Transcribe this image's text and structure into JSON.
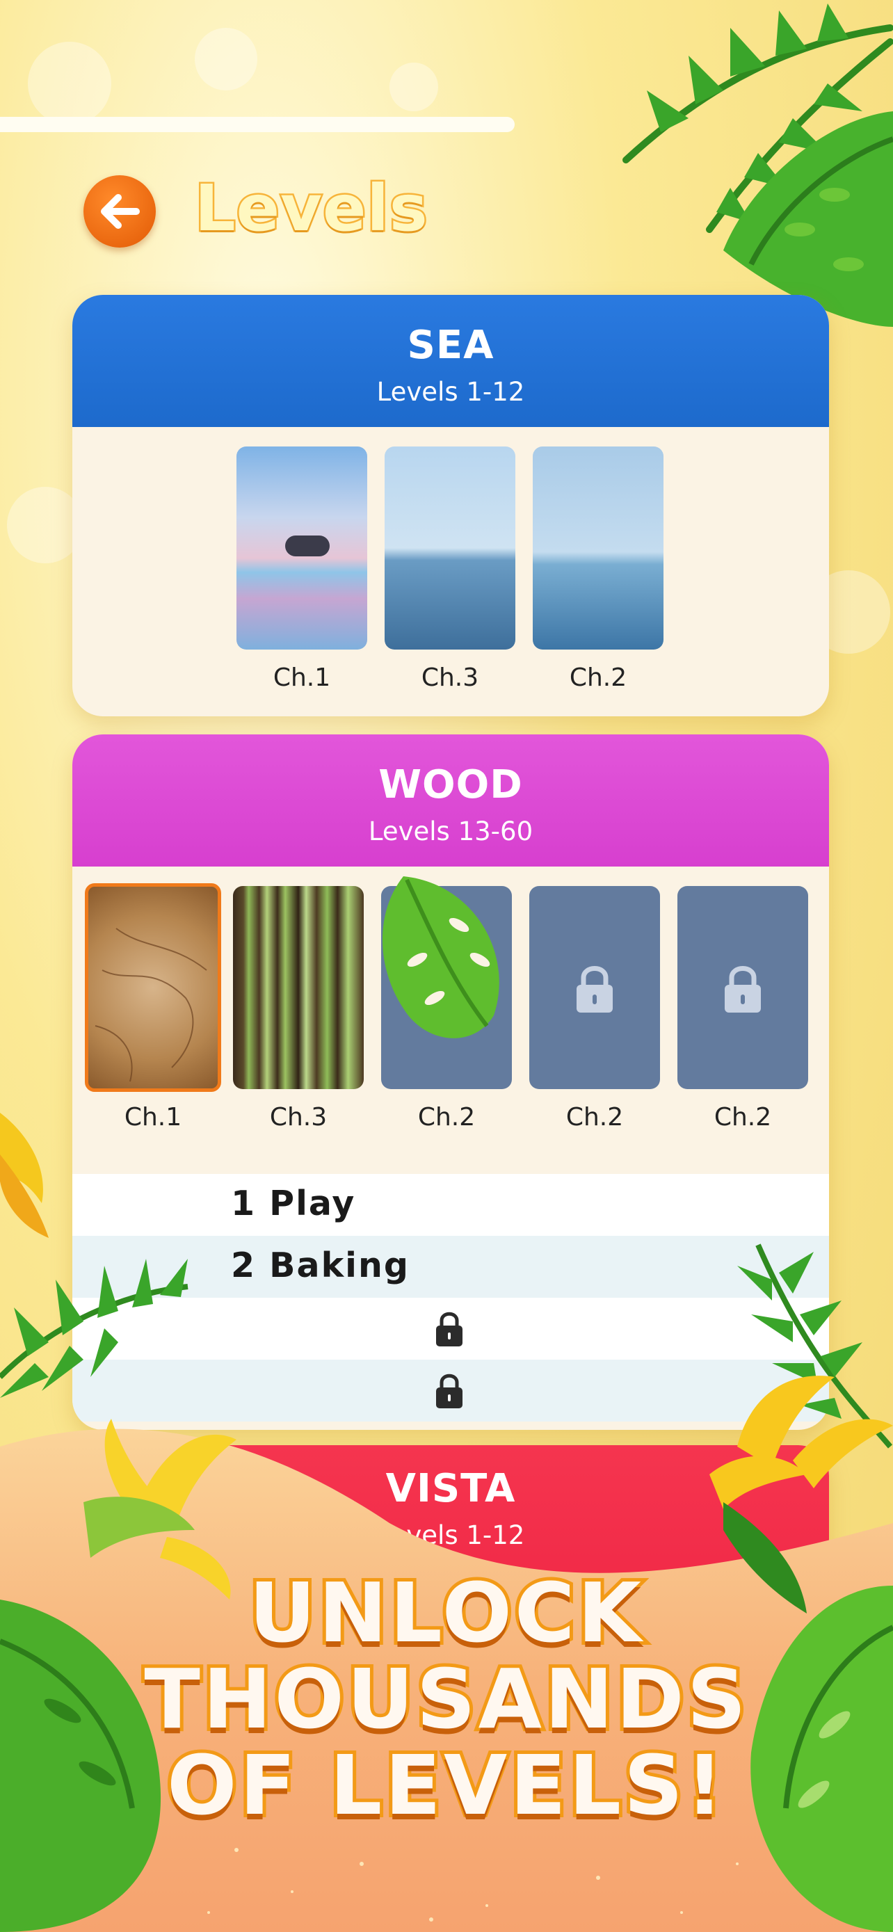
{
  "header": {
    "title": "Levels"
  },
  "icons": {
    "back": "arrow-left-icon",
    "lock": "lock-icon"
  },
  "colors": {
    "sea": "#1f6ed3",
    "wood": "#dd48d5",
    "vista": "#f22a48",
    "accent": "#ee6a0e",
    "locked": "#637b9e"
  },
  "categories": [
    {
      "name": "SEA",
      "range": "Levels 1-12",
      "chapters": [
        {
          "label": "Ch.1",
          "locked": false
        },
        {
          "label": "Ch.3",
          "locked": false
        },
        {
          "label": "Ch.2",
          "locked": false
        }
      ]
    },
    {
      "name": "WOOD",
      "range": "Levels 13-60",
      "chapters": [
        {
          "label": "Ch.1",
          "locked": false,
          "selected": true
        },
        {
          "label": "Ch.3",
          "locked": false
        },
        {
          "label": "Ch.2",
          "locked": false
        },
        {
          "label": "Ch.2",
          "locked": true
        },
        {
          "label": "Ch.2",
          "locked": true
        }
      ],
      "levels": [
        {
          "text": "1 Play",
          "locked": false
        },
        {
          "text": "2 Baking",
          "locked": false
        },
        {
          "text": "",
          "locked": true
        },
        {
          "text": "",
          "locked": true
        }
      ]
    },
    {
      "name": "VISTA",
      "range": "Levels 1-12"
    }
  ],
  "promo": {
    "lines": [
      "UNLOCK",
      "THOUSANDS",
      "OF LEVELS!"
    ]
  }
}
